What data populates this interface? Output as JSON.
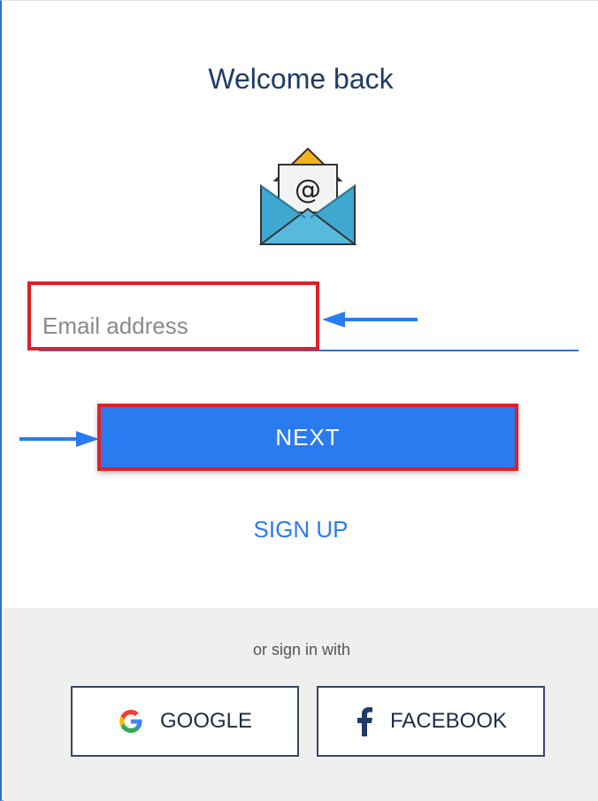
{
  "header": {
    "title": "Welcome back"
  },
  "form": {
    "email_placeholder": "Email address",
    "next_label": "NEXT",
    "signup_label": "SIGN UP"
  },
  "icons": {
    "mail": "email-envelope-icon",
    "google": "google-icon",
    "facebook": "facebook-icon",
    "annotation_arrow": "arrow-icon"
  },
  "social": {
    "prompt": "or sign in with",
    "google_label": "GOOGLE",
    "facebook_label": "FACEBOOK"
  },
  "colors": {
    "primary": "#2a7bf0",
    "highlight": "#e0202a",
    "title": "#1f3b66",
    "footer_bg": "#efefef"
  }
}
